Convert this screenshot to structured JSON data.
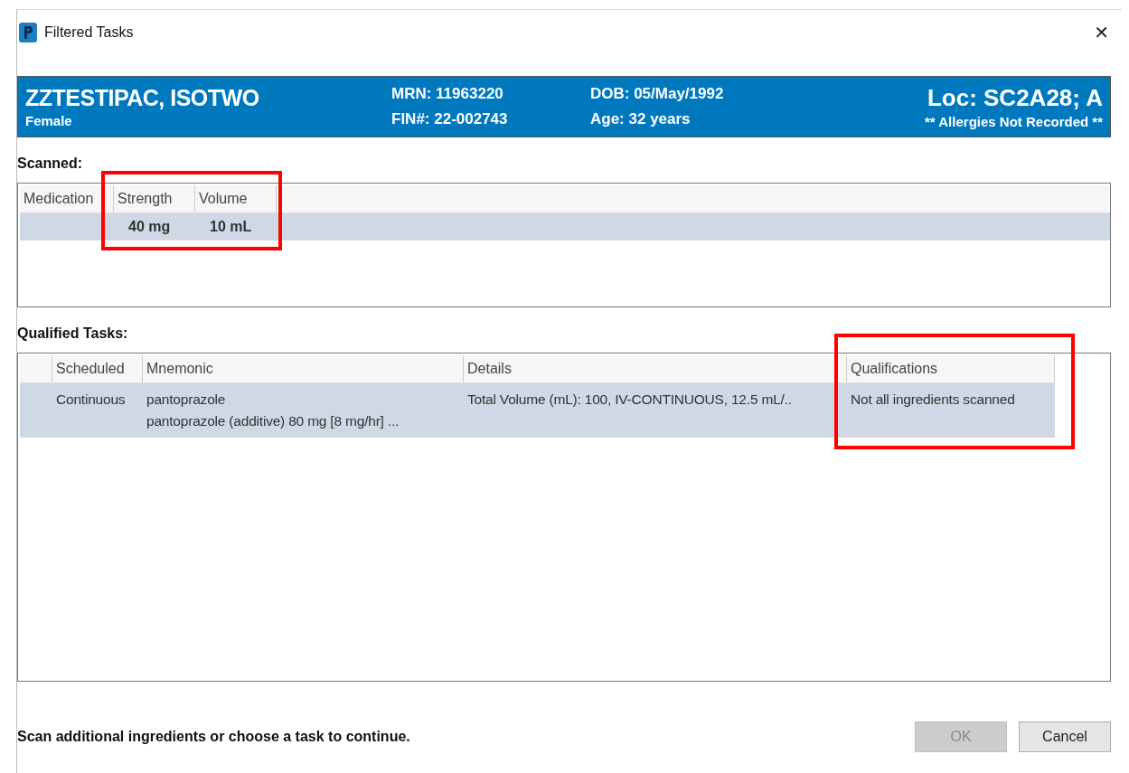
{
  "window": {
    "title": "Filtered Tasks",
    "close": "✕"
  },
  "patient": {
    "name": "ZZTESTIPAC, ISOTWO",
    "sex": "Female",
    "mrn": "MRN: 11963220",
    "fin": "FIN#: 22-002743",
    "dob": "DOB: 05/May/1992",
    "age": "Age: 32 years",
    "location": "Loc: SC2A28; A",
    "allergies": "** Allergies Not Recorded **"
  },
  "scanned": {
    "label": "Scanned:",
    "annotated": true,
    "columns": [
      "Medication",
      "Strength",
      "Volume"
    ],
    "rows": [
      {
        "selected": true,
        "cells": [
          null,
          "40 mg",
          "10 mL"
        ]
      }
    ]
  },
  "tasks": {
    "label": "Qualified Tasks:",
    "annotated": true,
    "columns": [
      "Scheduled",
      "Mnemonic",
      "Details",
      "Qualifications"
    ],
    "rows": [
      {
        "selected": true,
        "cells": [
          "Continuous",
          "pantoprazole\npantoprazole (additive) 80 mg [8 mg/hr] ...",
          "Total Volume (mL): 100, IV-CONTINUOUS, 12.5 mL/..",
          "Not all ingredients scanned"
        ]
      }
    ]
  },
  "status": "Scan additional ingredients or choose a task to continue.",
  "buttons": [
    {
      "label": "OK",
      "disabled": true
    },
    {
      "label": "Cancel",
      "disabled": false
    }
  ]
}
